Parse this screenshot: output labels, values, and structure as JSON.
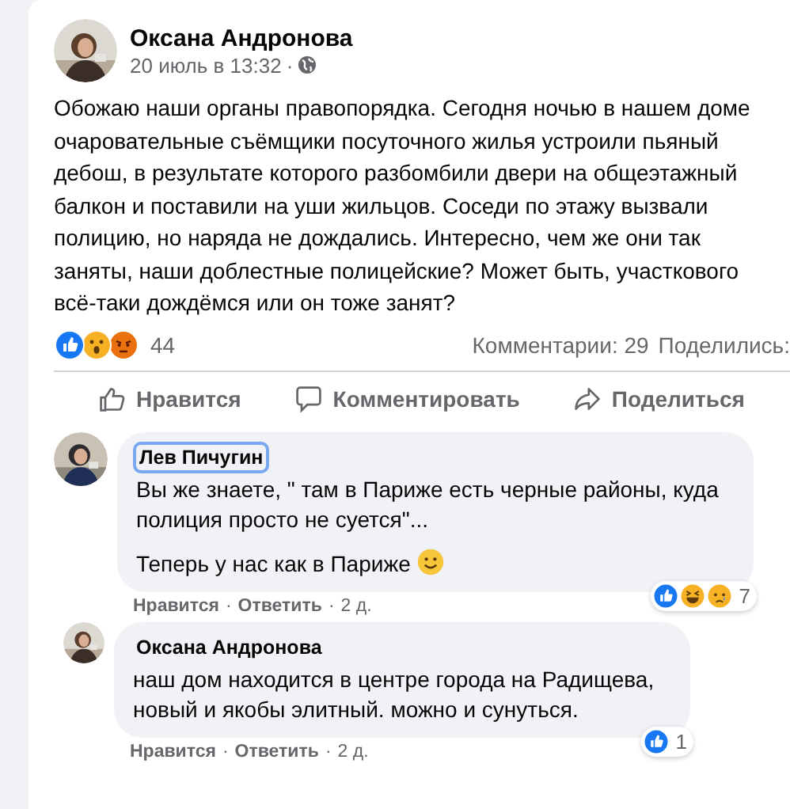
{
  "post": {
    "author": "Оксана Андронова",
    "date": "20 июль в 13:32",
    "separator": "·",
    "text": "Обожаю наши органы правопорядка. Сегодня ночью в нашем доме очаровательные съёмщики посуточного жилья устроили пьяный дебош, в результате которого разбомбили двери на общеэтажный балкон и поставили на уши жильцов. Соседи по этажу вызвали полицию, но наряда не дождались. Интересно, чем же они так заняты, наши доблестные полицейские? Может быть, участкового всё-таки дождёмся или он тоже занят?",
    "reactions": [
      {
        "kind": "like"
      },
      {
        "kind": "wow"
      },
      {
        "kind": "angry"
      }
    ],
    "reaction_count": "44",
    "comments_count": "Комментарии: 29",
    "shares_count": "Поделились:",
    "actions": [
      {
        "kind": "like",
        "label": "Нравится"
      },
      {
        "kind": "comment",
        "label": "Комментировать"
      },
      {
        "kind": "share",
        "label": "Поделиться"
      }
    ]
  },
  "comments": [
    {
      "author": "Лев Пичугин",
      "focused": true,
      "paragraphs": [
        {
          "text": "Вы же знаете, \" там в Париже есть черные районы, куда полиция просто не суется\"..."
        },
        {
          "text": "Теперь у нас как в Париже",
          "emoji": {
            "kind": "smile"
          }
        }
      ],
      "reactions": [
        {
          "kind": "like"
        },
        {
          "kind": "haha"
        },
        {
          "kind": "sad"
        }
      ],
      "reaction_count": "7",
      "like": "Нравится",
      "reply": "Ответить",
      "age": "2 д.",
      "separator": "·",
      "replies": [
        {
          "author": "Оксана Андронова",
          "focused": false,
          "paragraphs": [
            {
              "text": "наш дом находится в центре города на Радищева, новый и якобы элитный. можно и сунуться."
            }
          ],
          "reactions": [
            {
              "kind": "like"
            }
          ],
          "reaction_count": "1",
          "like": "Нравится",
          "reply": "Ответить",
          "age": "2 д.",
          "separator": "·"
        }
      ]
    }
  ]
}
